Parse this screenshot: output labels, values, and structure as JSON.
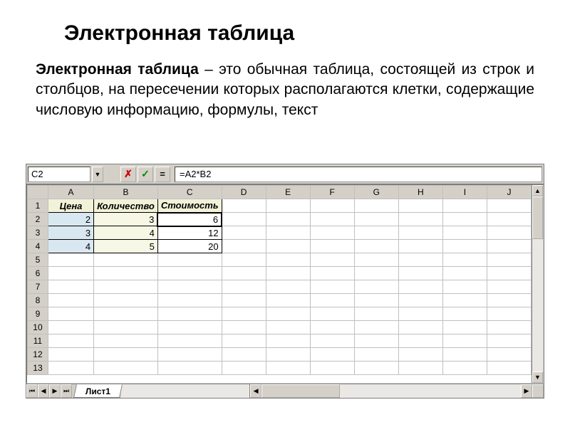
{
  "title": "Электронная таблица",
  "desc_bold": "Электронная таблица",
  "desc_rest": " – это обычная таблица, состоящей из строк и столбцов, на пересечении которых располагаются клетки, содержащие числовую информацию, формулы, текст",
  "spreadsheet": {
    "active_cell": "C2",
    "formula": "=A2*B2",
    "columns": [
      "A",
      "B",
      "C",
      "D",
      "E",
      "F",
      "G",
      "H",
      "I",
      "J"
    ],
    "rows": [
      "1",
      "2",
      "3",
      "4",
      "5",
      "6",
      "7",
      "8",
      "9",
      "10",
      "11",
      "12",
      "13"
    ],
    "data": {
      "r1": {
        "A": "Цена",
        "B": "Количество",
        "C": "Стоимость"
      },
      "r2": {
        "A": "2",
        "B": "3",
        "C": "6"
      },
      "r3": {
        "A": "3",
        "B": "4",
        "C": "12"
      },
      "r4": {
        "A": "4",
        "B": "5",
        "C": "20"
      }
    },
    "sheet_tab": "Лист1"
  }
}
